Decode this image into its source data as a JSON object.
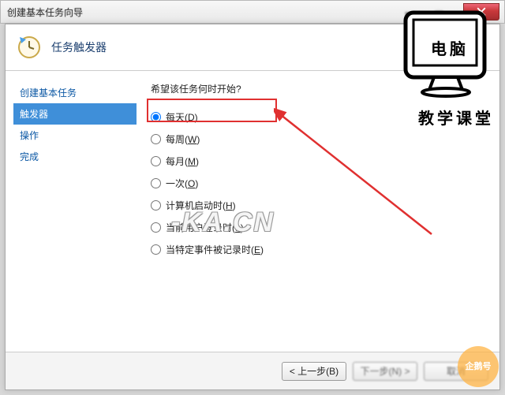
{
  "titlebar": {
    "title": "创建基本任务向导"
  },
  "header": {
    "title": "任务触发器"
  },
  "sidebar": {
    "items": [
      {
        "label": "创建基本任务"
      },
      {
        "label": "触发器"
      },
      {
        "label": "操作"
      },
      {
        "label": "完成"
      }
    ],
    "active_index": 1
  },
  "main": {
    "question": "希望该任务何时开始?",
    "options": [
      {
        "label_pre": "每天(",
        "hotkey": "D",
        "label_post": ")",
        "checked": true
      },
      {
        "label_pre": "每周(",
        "hotkey": "W",
        "label_post": ")",
        "checked": false
      },
      {
        "label_pre": "每月(",
        "hotkey": "M",
        "label_post": ")",
        "checked": false
      },
      {
        "label_pre": "一次(",
        "hotkey": "O",
        "label_post": ")",
        "checked": false
      },
      {
        "label_pre": "计算机启动时(",
        "hotkey": "H",
        "label_post": ")",
        "checked": false
      },
      {
        "label_pre": "当前用户登录时(",
        "hotkey": "L",
        "label_post": ")",
        "checked": false
      },
      {
        "label_pre": "当特定事件被记录时(",
        "hotkey": "E",
        "label_post": ")",
        "checked": false
      }
    ]
  },
  "footer": {
    "back": "< 上一步(B)",
    "next": "下一步(N) >",
    "cancel": "取消"
  },
  "watermark": {
    "text": "-KA.CN"
  },
  "education": {
    "line1": "电脑",
    "line2": "教学课堂"
  },
  "corner_icon": {
    "text": "企鹅号"
  }
}
